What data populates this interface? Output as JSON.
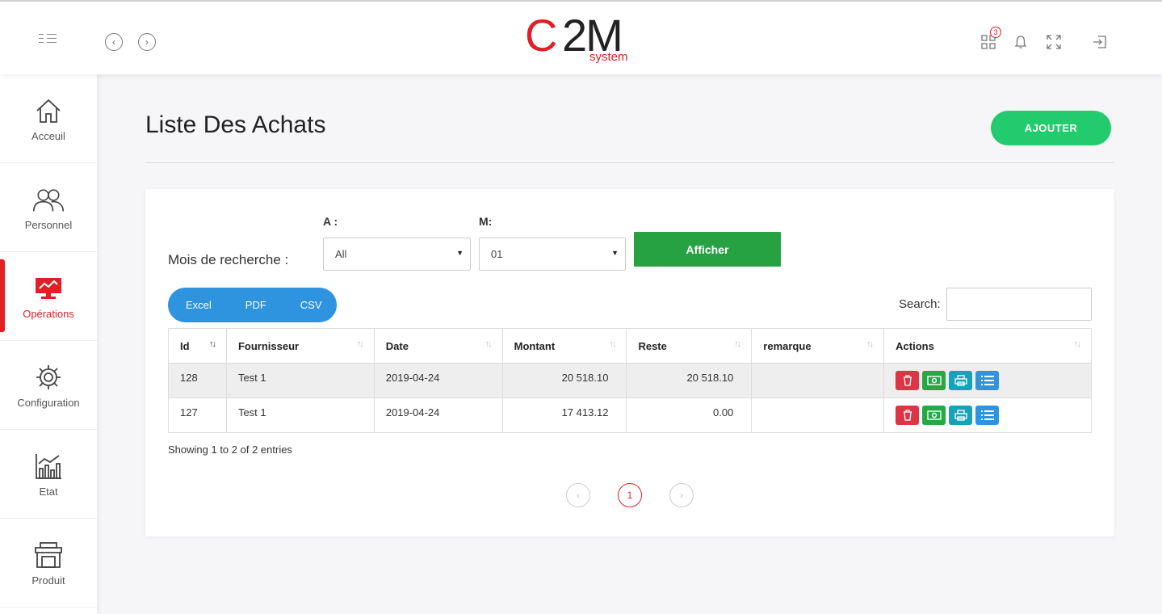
{
  "header": {
    "logo": {
      "c": "C",
      "rest": "2M",
      "system": "system"
    },
    "notifications_count": "3"
  },
  "sidebar": {
    "items": [
      {
        "label": "Acceuil",
        "icon": "home-icon"
      },
      {
        "label": "Personnel",
        "icon": "users-icon"
      },
      {
        "label": "Opérations",
        "icon": "monitor-chart-icon",
        "active": true
      },
      {
        "label": "Configuration",
        "icon": "gear-icon"
      },
      {
        "label": "Etat",
        "icon": "bar-chart-icon"
      },
      {
        "label": "Produit",
        "icon": "store-icon"
      }
    ]
  },
  "page": {
    "title": "Liste Des Achats",
    "add_label": "AJOUTER"
  },
  "filter": {
    "label": "Mois de recherche :",
    "year_label": "A :",
    "year_value": "All",
    "month_label": "M:",
    "month_value": "01",
    "show_label": "Afficher"
  },
  "export": {
    "excel": "Excel",
    "pdf": "PDF",
    "csv": "CSV"
  },
  "search": {
    "label": "Search:",
    "value": ""
  },
  "table": {
    "headers": [
      "Id",
      "Fournisseur",
      "Date",
      "Montant",
      "Reste",
      "remarque",
      "Actions"
    ],
    "rows": [
      {
        "id": "128",
        "fournisseur": "Test 1",
        "date": "2019-04-24",
        "montant": "20 518.10",
        "reste": "20 518.10",
        "remarque": ""
      },
      {
        "id": "127",
        "fournisseur": "Test 1",
        "date": "2019-04-24",
        "montant": "17 413.12",
        "reste": "0.00",
        "remarque": ""
      }
    ]
  },
  "info": "Showing 1 to 2 of 2 entries",
  "pagination": {
    "current": "1"
  },
  "colors": {
    "brand_red": "#e01f26",
    "green": "#22cc6e",
    "blue": "#2f94df"
  }
}
